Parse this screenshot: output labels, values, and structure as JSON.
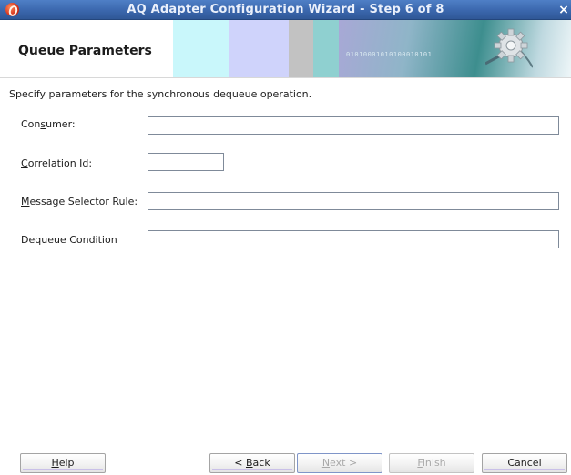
{
  "window": {
    "title": "AQ Adapter Configuration Wizard - Step 6 of 8",
    "close_glyph": "×"
  },
  "header": {
    "title": "Queue Parameters",
    "banner_text": "01010001010100010101"
  },
  "instruction": "Specify parameters for the synchronous dequeue operation.",
  "fields": {
    "consumer": {
      "label_pre": "Con",
      "label_mnemonic": "s",
      "label_post": "umer:",
      "value": ""
    },
    "correlation_id": {
      "label_pre": "",
      "label_mnemonic": "C",
      "label_post": "orrelation Id:",
      "value": ""
    },
    "message_selector_rule": {
      "label_pre": "",
      "label_mnemonic": "M",
      "label_post": "essage Selector Rule:",
      "value": ""
    },
    "dequeue_condition": {
      "label_pre": "Dequeue Condition",
      "label_mnemonic": "",
      "label_post": "",
      "value": ""
    }
  },
  "buttons": {
    "help": {
      "mnemonic": "H",
      "rest": "elp"
    },
    "back": {
      "pre": "< ",
      "mnemonic": "B",
      "rest": "ack"
    },
    "next": {
      "mnemonic": "N",
      "rest": "ext >"
    },
    "finish": {
      "mnemonic": "F",
      "rest": "inish"
    },
    "cancel": {
      "label": "Cancel"
    }
  }
}
